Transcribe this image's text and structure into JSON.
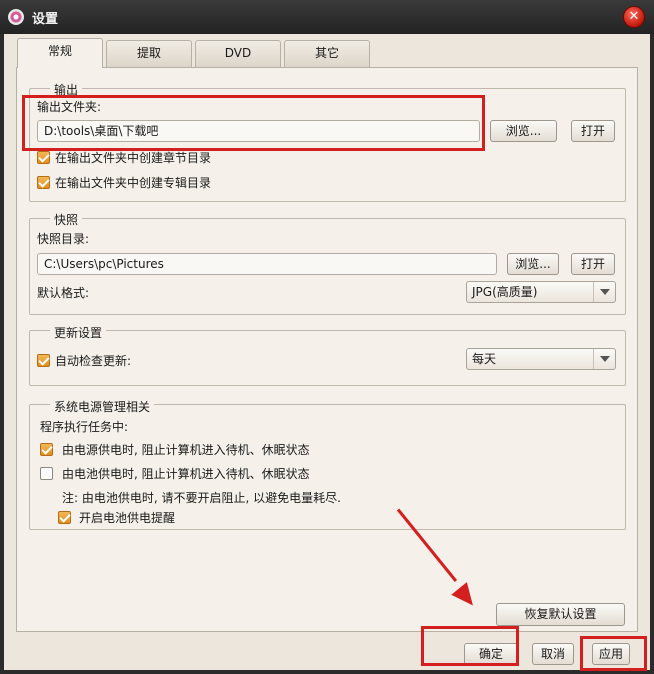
{
  "window": {
    "title": "设置",
    "close_symbol": "✕"
  },
  "tabs": [
    {
      "label": "常规",
      "active": true
    },
    {
      "label": "提取",
      "active": false
    },
    {
      "label": "DVD",
      "active": false
    },
    {
      "label": "其它",
      "active": false
    }
  ],
  "output": {
    "legend": "输出",
    "folder_label": "输出文件夹:",
    "folder_value": "D:\\tools\\桌面\\下载吧",
    "browse": "浏览...",
    "open": "打开",
    "chapter_dir": {
      "label": "在输出文件夹中创建章节目录",
      "checked": true
    },
    "album_dir": {
      "label": "在输出文件夹中创建专辑目录",
      "checked": true
    }
  },
  "snapshot": {
    "legend": "快照",
    "dir_label": "快照目录:",
    "dir_value": "C:\\Users\\pc\\Pictures",
    "browse": "浏览...",
    "open": "打开",
    "format_label": "默认格式:",
    "format_value": "JPG(高质量)"
  },
  "update": {
    "legend": "更新设置",
    "auto_check": {
      "label": "自动检查更新:",
      "checked": true
    },
    "frequency_value": "每天"
  },
  "power": {
    "legend": "系统电源管理相关",
    "intro": "程序执行任务中:",
    "ac_power": {
      "label": "由电源供电时, 阻止计算机进入待机、休眠状态",
      "checked": true
    },
    "battery_power": {
      "label": "由电池供电时, 阻止计算机进入待机、休眠状态",
      "checked": false
    },
    "note": "注: 由电池供电时, 请不要开启阻止, 以避免电量耗尽.",
    "battery_reminder": {
      "label": "开启电池供电提醒",
      "checked": true
    }
  },
  "footer": {
    "restore_defaults": "恢复默认设置",
    "ok": "确定",
    "cancel": "取消",
    "apply": "应用"
  },
  "colors": {
    "highlight": "#d41f1f",
    "checkbox_checked": "#e38e1c",
    "dialog_bg": "#ece6dc"
  }
}
